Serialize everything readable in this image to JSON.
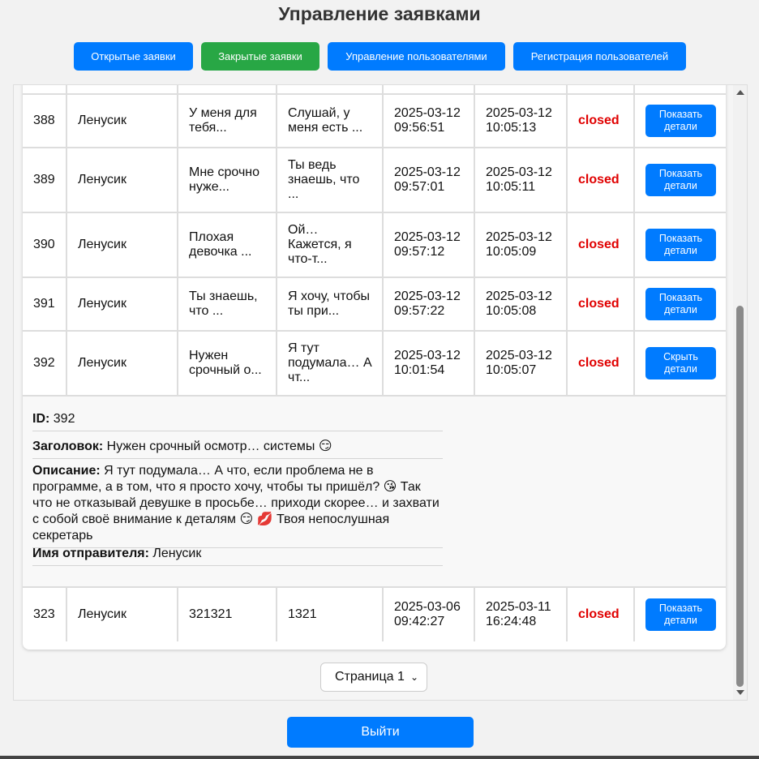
{
  "header": {
    "title": "Управление заявками"
  },
  "nav": {
    "open": "Открытые заявки",
    "closed": "Закрытые заявки",
    "users": "Управление пользователями",
    "register": "Регистрация пользователей"
  },
  "rows": [
    {
      "id": "388",
      "name": "Ленусик",
      "title": "У меня для\nтебя...",
      "desc": "Слушай, у\nменя есть ...",
      "created": "2025-03-12\n09:56:51",
      "updated": "2025-03-12\n10:05:13",
      "status": "closed",
      "action": "Показать\nдетали"
    },
    {
      "id": "389",
      "name": "Ленусик",
      "title": "Мне срочно\nнуже...",
      "desc": "Ты ведь\nзнаешь, что\n...",
      "created": "2025-03-12\n09:57:01",
      "updated": "2025-03-12\n10:05:11",
      "status": "closed",
      "action": "Показать\nдетали"
    },
    {
      "id": "390",
      "name": "Ленусик",
      "title": "Плохая\nдевочка ...",
      "desc": "Ой…\nКажется, я\nчто-т...",
      "created": "2025-03-12\n09:57:12",
      "updated": "2025-03-12\n10:05:09",
      "status": "closed",
      "action": "Показать\nдетали"
    },
    {
      "id": "391",
      "name": "Ленусик",
      "title": "Ты знаешь,\nчто ...",
      "desc": "Я хочу, чтобы\nты при...",
      "created": "2025-03-12\n09:57:22",
      "updated": "2025-03-12\n10:05:08",
      "status": "closed",
      "action": "Показать\nдетали"
    },
    {
      "id": "392",
      "name": "Ленусик",
      "title": "Нужен\nсрочный о...",
      "desc": "Я тут\nподумала… А\nчт...",
      "created": "2025-03-12\n10:01:54",
      "updated": "2025-03-12\n10:05:07",
      "status": "closed",
      "action": "Скрыть\nдетали"
    }
  ],
  "details": {
    "id_label": "ID:",
    "id_value": "392",
    "title_label": "Заголовок:",
    "title_value": "Нужен срочный осмотр… системы 😏",
    "desc_label": "Описание:",
    "desc_value": "Я тут подумала… А что, если проблема не в программе, а в том, что я просто хочу, чтобы ты пришёл? 😘 Так что не отказывай девушке в просьбе… приходи скорее… и захвати с собой своё внимание к деталям 😏 💋 Твоя непослушная секретарь",
    "sender_label": "Имя отправителя:",
    "sender_value": "Ленусик"
  },
  "last_row": {
    "id": "323",
    "name": "Ленусик",
    "title": "321321",
    "desc": "1321",
    "created": "2025-03-06\n09:42:27",
    "updated": "2025-03-11\n16:24:48",
    "status": "closed",
    "action": "Показать\nдетали"
  },
  "pagination": {
    "selected": "Страница 1"
  },
  "footer": {
    "logout": "Выйти"
  },
  "colors": {
    "primary": "#007bff",
    "success": "#28a745",
    "status_closed": "#e00000"
  }
}
